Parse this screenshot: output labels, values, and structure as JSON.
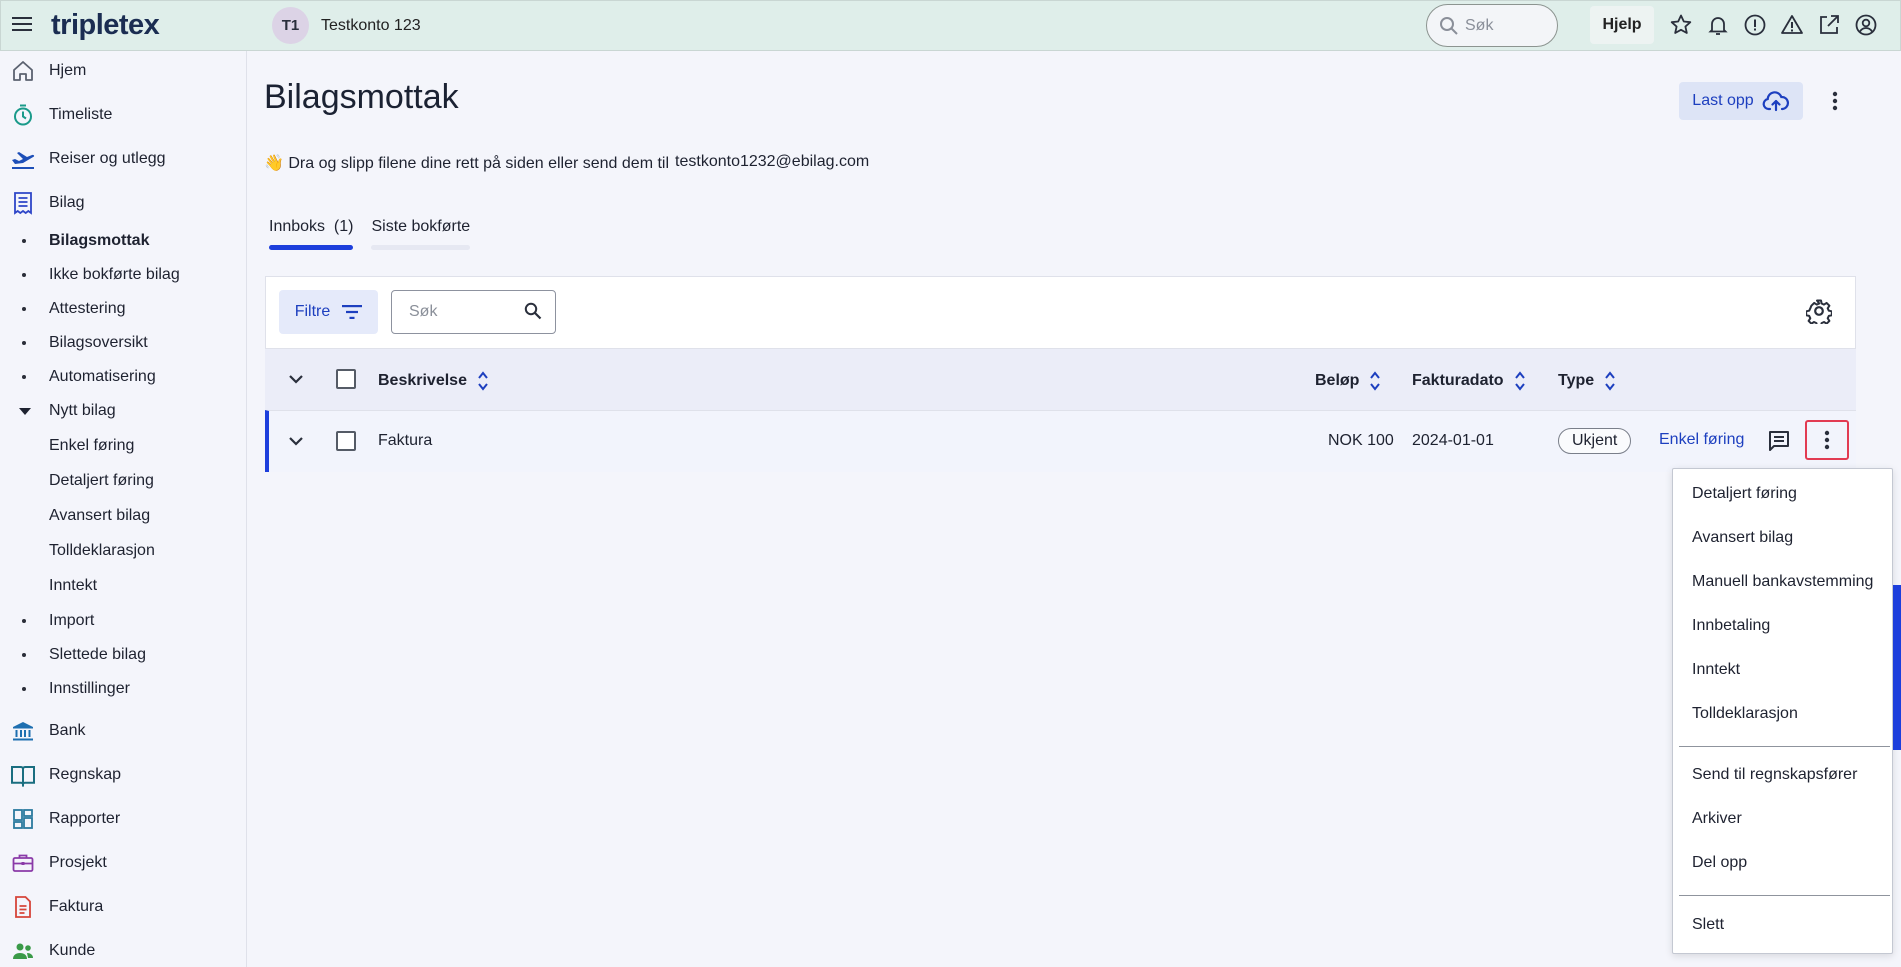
{
  "header": {
    "logo": "tripletex",
    "company_initials": "T1",
    "company_name": "Testkonto 123",
    "search_placeholder": "Søk",
    "help_label": "Hjelp"
  },
  "sidebar": {
    "main_items": [
      {
        "label": "Hjem",
        "icon": "home-icon"
      },
      {
        "label": "Timeliste",
        "icon": "stopwatch-icon"
      },
      {
        "label": "Reiser og utlegg",
        "icon": "plane-icon"
      },
      {
        "label": "Bilag",
        "icon": "receipt-icon"
      }
    ],
    "bilag_subitems": [
      "Bilagsmottak",
      "Ikke bokførte bilag",
      "Attestering",
      "Bilagsoversikt",
      "Automatisering",
      "Nytt bilag"
    ],
    "nytt_bilag_subitems": [
      "Enkel føring",
      "Detaljert føring",
      "Avansert bilag",
      "Tolldeklarasjon",
      "Inntekt"
    ],
    "more_subitems": [
      "Import",
      "Slettede bilag",
      "Innstillinger"
    ],
    "lower_items": [
      {
        "label": "Bank",
        "icon": "bank-icon"
      },
      {
        "label": "Regnskap",
        "icon": "book-icon"
      },
      {
        "label": "Rapporter",
        "icon": "dashboard-icon"
      },
      {
        "label": "Prosjekt",
        "icon": "briefcase-icon"
      },
      {
        "label": "Faktura",
        "icon": "invoice-icon"
      },
      {
        "label": "Kunde",
        "icon": "people-icon"
      }
    ]
  },
  "main": {
    "title": "Bilagsmottak",
    "upload_label": "Last opp",
    "drop_text": "👋 Dra og slipp filene dine rett på siden eller send dem til",
    "email": "testkonto1232@ebilag.com",
    "tabs": [
      {
        "label": "Innboks  (1)",
        "active": true
      },
      {
        "label": "Siste bokførte",
        "active": false
      }
    ],
    "filter_label": "Filtre",
    "table_search_placeholder": "Søk",
    "columns": {
      "description": "Beskrivelse",
      "amount": "Beløp",
      "invoice_date": "Fakturadato",
      "type": "Type"
    },
    "rows": [
      {
        "description": "Faktura",
        "amount": "NOK 100",
        "invoice_date": "2024-01-01",
        "type": "Ukjent",
        "action": "Enkel føring"
      }
    ]
  },
  "menu": {
    "group1": [
      "Detaljert føring",
      "Avansert bilag",
      "Manuell bankavstemming",
      "Innbetaling",
      "Inntekt",
      "Tolldeklarasjon"
    ],
    "group2": [
      "Send til regnskapsfører",
      "Arkiver",
      "Del opp"
    ],
    "group3": [
      "Slett"
    ]
  },
  "colors": {
    "accent": "#1d3fdc",
    "header_bg": "#dfeeea",
    "highlight_border": "#e23b52"
  }
}
